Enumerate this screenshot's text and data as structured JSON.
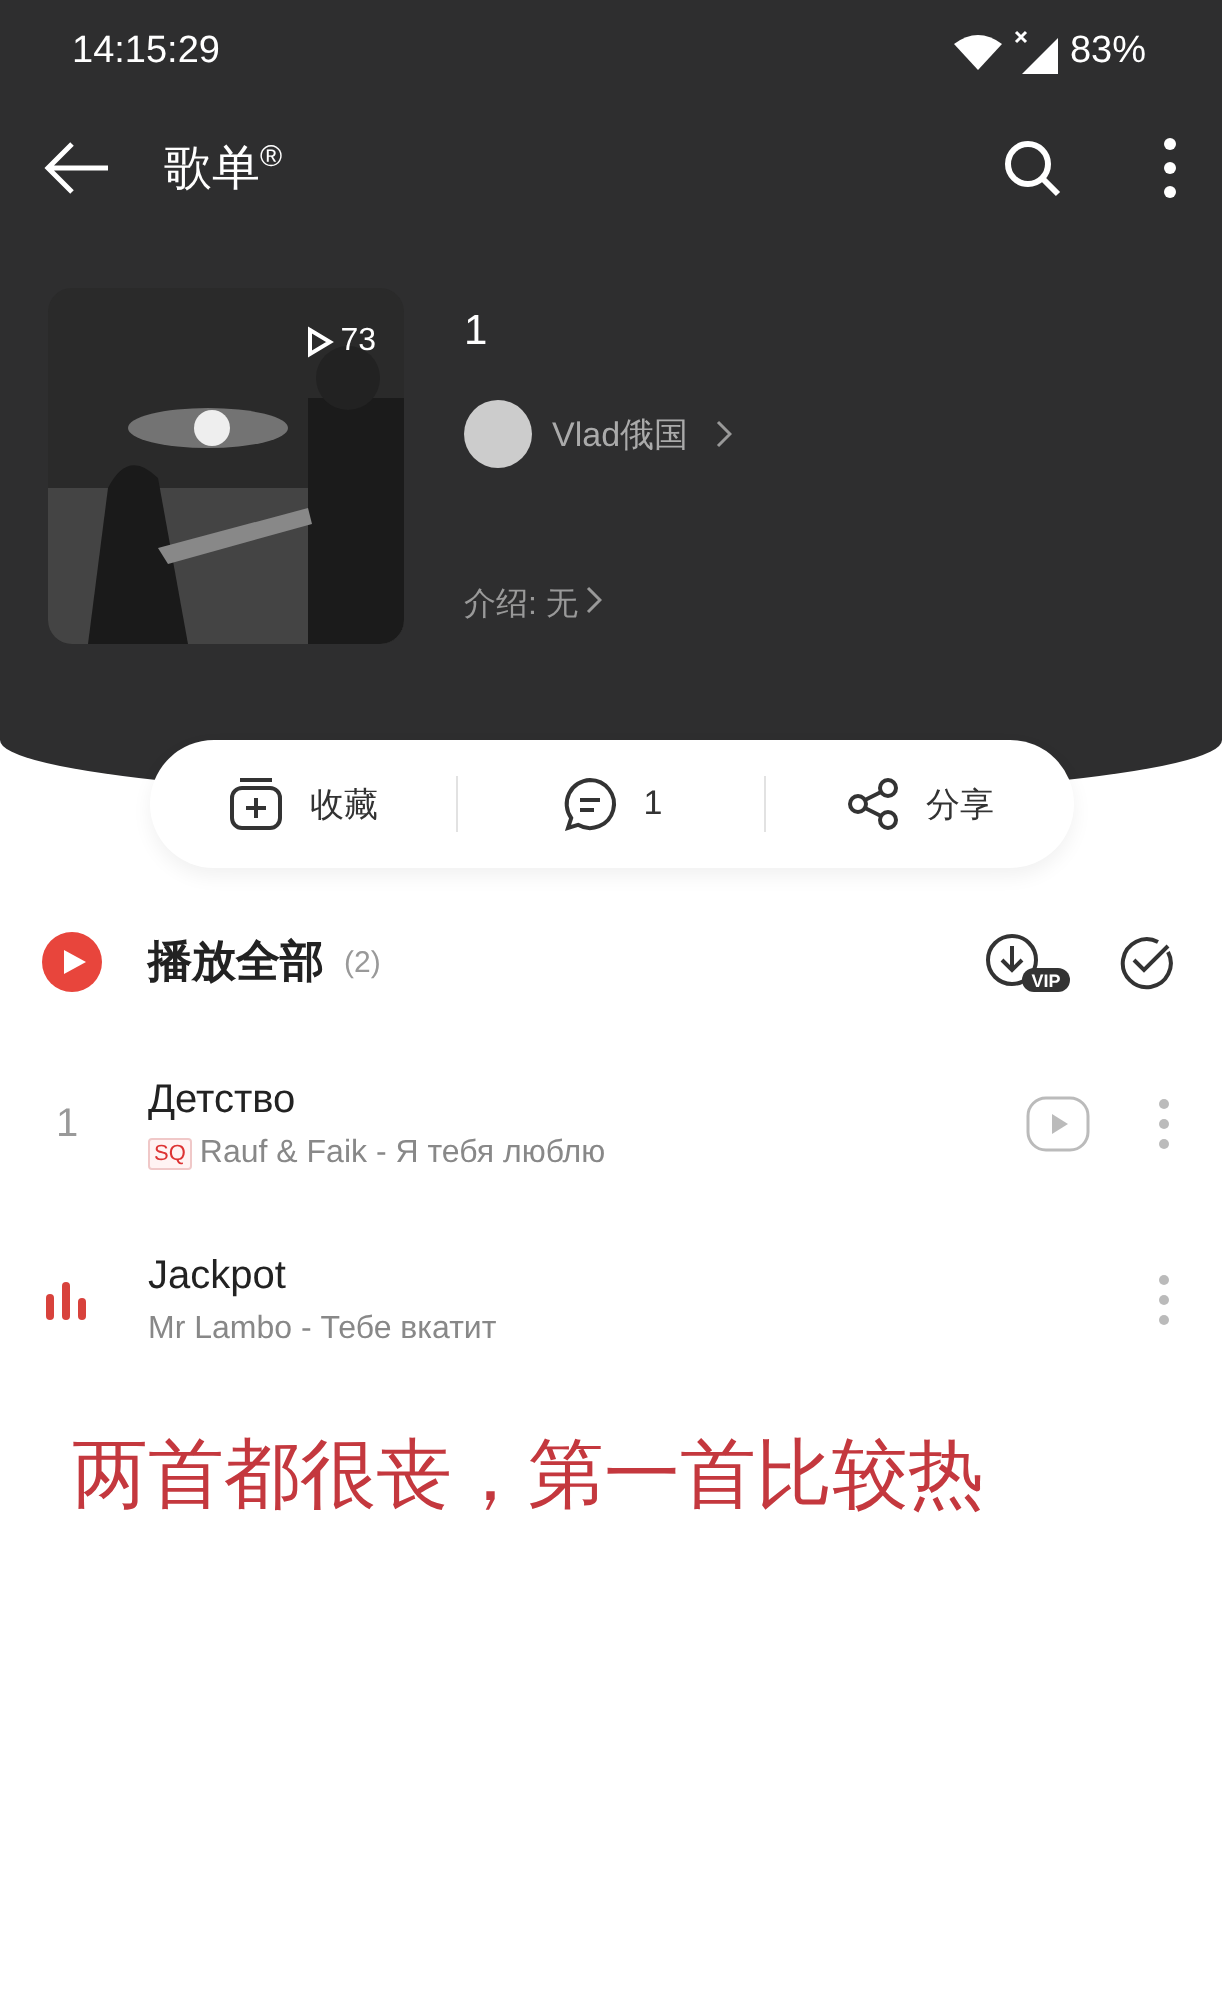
{
  "status_bar": {
    "time": "14:15:29",
    "battery": "83%"
  },
  "app_bar": {
    "title": "歌单",
    "title_mark": "®"
  },
  "playlist": {
    "cover": {
      "kind": "picture",
      "play_count": "73"
    },
    "name": "1",
    "creator": "Vlad俄国",
    "intro": "介绍: 无"
  },
  "actions": [
    {
      "kind": "collect",
      "label": "收藏"
    },
    {
      "kind": "comment",
      "label": "1"
    },
    {
      "kind": "share",
      "label": "分享"
    }
  ],
  "play_all": {
    "label": "播放全部",
    "count": "(2)",
    "vip": "VIP"
  },
  "songs": [
    {
      "index": "1",
      "playing": false,
      "title": "Детство",
      "sq": "SQ",
      "subtitle": "Rauf & Faik - Я тебя люблю",
      "mv": true
    },
    {
      "playing": true,
      "title": "Jackpot",
      "subtitle": "Mr Lambo - Тебе вкатит",
      "mv": false
    }
  ],
  "caption": "两首都很丧，第一首比较热"
}
